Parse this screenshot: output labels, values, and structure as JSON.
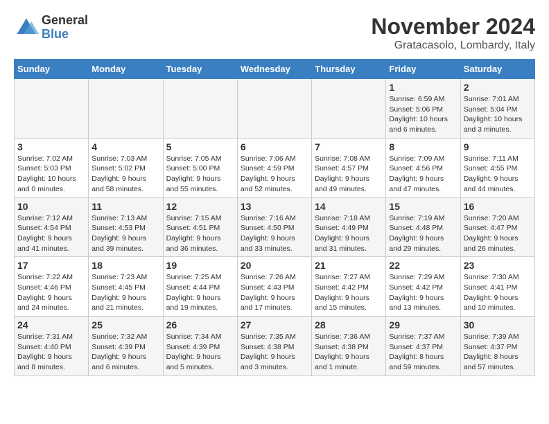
{
  "logo": {
    "general": "General",
    "blue": "Blue"
  },
  "title": "November 2024",
  "location": "Gratacasolo, Lombardy, Italy",
  "weekdays": [
    "Sunday",
    "Monday",
    "Tuesday",
    "Wednesday",
    "Thursday",
    "Friday",
    "Saturday"
  ],
  "weeks": [
    [
      {
        "day": "",
        "info": ""
      },
      {
        "day": "",
        "info": ""
      },
      {
        "day": "",
        "info": ""
      },
      {
        "day": "",
        "info": ""
      },
      {
        "day": "",
        "info": ""
      },
      {
        "day": "1",
        "info": "Sunrise: 6:59 AM\nSunset: 5:06 PM\nDaylight: 10 hours\nand 6 minutes."
      },
      {
        "day": "2",
        "info": "Sunrise: 7:01 AM\nSunset: 5:04 PM\nDaylight: 10 hours\nand 3 minutes."
      }
    ],
    [
      {
        "day": "3",
        "info": "Sunrise: 7:02 AM\nSunset: 5:03 PM\nDaylight: 10 hours\nand 0 minutes."
      },
      {
        "day": "4",
        "info": "Sunrise: 7:03 AM\nSunset: 5:02 PM\nDaylight: 9 hours\nand 58 minutes."
      },
      {
        "day": "5",
        "info": "Sunrise: 7:05 AM\nSunset: 5:00 PM\nDaylight: 9 hours\nand 55 minutes."
      },
      {
        "day": "6",
        "info": "Sunrise: 7:06 AM\nSunset: 4:59 PM\nDaylight: 9 hours\nand 52 minutes."
      },
      {
        "day": "7",
        "info": "Sunrise: 7:08 AM\nSunset: 4:57 PM\nDaylight: 9 hours\nand 49 minutes."
      },
      {
        "day": "8",
        "info": "Sunrise: 7:09 AM\nSunset: 4:56 PM\nDaylight: 9 hours\nand 47 minutes."
      },
      {
        "day": "9",
        "info": "Sunrise: 7:11 AM\nSunset: 4:55 PM\nDaylight: 9 hours\nand 44 minutes."
      }
    ],
    [
      {
        "day": "10",
        "info": "Sunrise: 7:12 AM\nSunset: 4:54 PM\nDaylight: 9 hours\nand 41 minutes."
      },
      {
        "day": "11",
        "info": "Sunrise: 7:13 AM\nSunset: 4:53 PM\nDaylight: 9 hours\nand 39 minutes."
      },
      {
        "day": "12",
        "info": "Sunrise: 7:15 AM\nSunset: 4:51 PM\nDaylight: 9 hours\nand 36 minutes."
      },
      {
        "day": "13",
        "info": "Sunrise: 7:16 AM\nSunset: 4:50 PM\nDaylight: 9 hours\nand 33 minutes."
      },
      {
        "day": "14",
        "info": "Sunrise: 7:18 AM\nSunset: 4:49 PM\nDaylight: 9 hours\nand 31 minutes."
      },
      {
        "day": "15",
        "info": "Sunrise: 7:19 AM\nSunset: 4:48 PM\nDaylight: 9 hours\nand 29 minutes."
      },
      {
        "day": "16",
        "info": "Sunrise: 7:20 AM\nSunset: 4:47 PM\nDaylight: 9 hours\nand 26 minutes."
      }
    ],
    [
      {
        "day": "17",
        "info": "Sunrise: 7:22 AM\nSunset: 4:46 PM\nDaylight: 9 hours\nand 24 minutes."
      },
      {
        "day": "18",
        "info": "Sunrise: 7:23 AM\nSunset: 4:45 PM\nDaylight: 9 hours\nand 21 minutes."
      },
      {
        "day": "19",
        "info": "Sunrise: 7:25 AM\nSunset: 4:44 PM\nDaylight: 9 hours\nand 19 minutes."
      },
      {
        "day": "20",
        "info": "Sunrise: 7:26 AM\nSunset: 4:43 PM\nDaylight: 9 hours\nand 17 minutes."
      },
      {
        "day": "21",
        "info": "Sunrise: 7:27 AM\nSunset: 4:42 PM\nDaylight: 9 hours\nand 15 minutes."
      },
      {
        "day": "22",
        "info": "Sunrise: 7:29 AM\nSunset: 4:42 PM\nDaylight: 9 hours\nand 13 minutes."
      },
      {
        "day": "23",
        "info": "Sunrise: 7:30 AM\nSunset: 4:41 PM\nDaylight: 9 hours\nand 10 minutes."
      }
    ],
    [
      {
        "day": "24",
        "info": "Sunrise: 7:31 AM\nSunset: 4:40 PM\nDaylight: 9 hours\nand 8 minutes."
      },
      {
        "day": "25",
        "info": "Sunrise: 7:32 AM\nSunset: 4:39 PM\nDaylight: 9 hours\nand 6 minutes."
      },
      {
        "day": "26",
        "info": "Sunrise: 7:34 AM\nSunset: 4:39 PM\nDaylight: 9 hours\nand 5 minutes."
      },
      {
        "day": "27",
        "info": "Sunrise: 7:35 AM\nSunset: 4:38 PM\nDaylight: 9 hours\nand 3 minutes."
      },
      {
        "day": "28",
        "info": "Sunrise: 7:36 AM\nSunset: 4:38 PM\nDaylight: 9 hours\nand 1 minute."
      },
      {
        "day": "29",
        "info": "Sunrise: 7:37 AM\nSunset: 4:37 PM\nDaylight: 8 hours\nand 59 minutes."
      },
      {
        "day": "30",
        "info": "Sunrise: 7:39 AM\nSunset: 4:37 PM\nDaylight: 8 hours\nand 57 minutes."
      }
    ]
  ]
}
